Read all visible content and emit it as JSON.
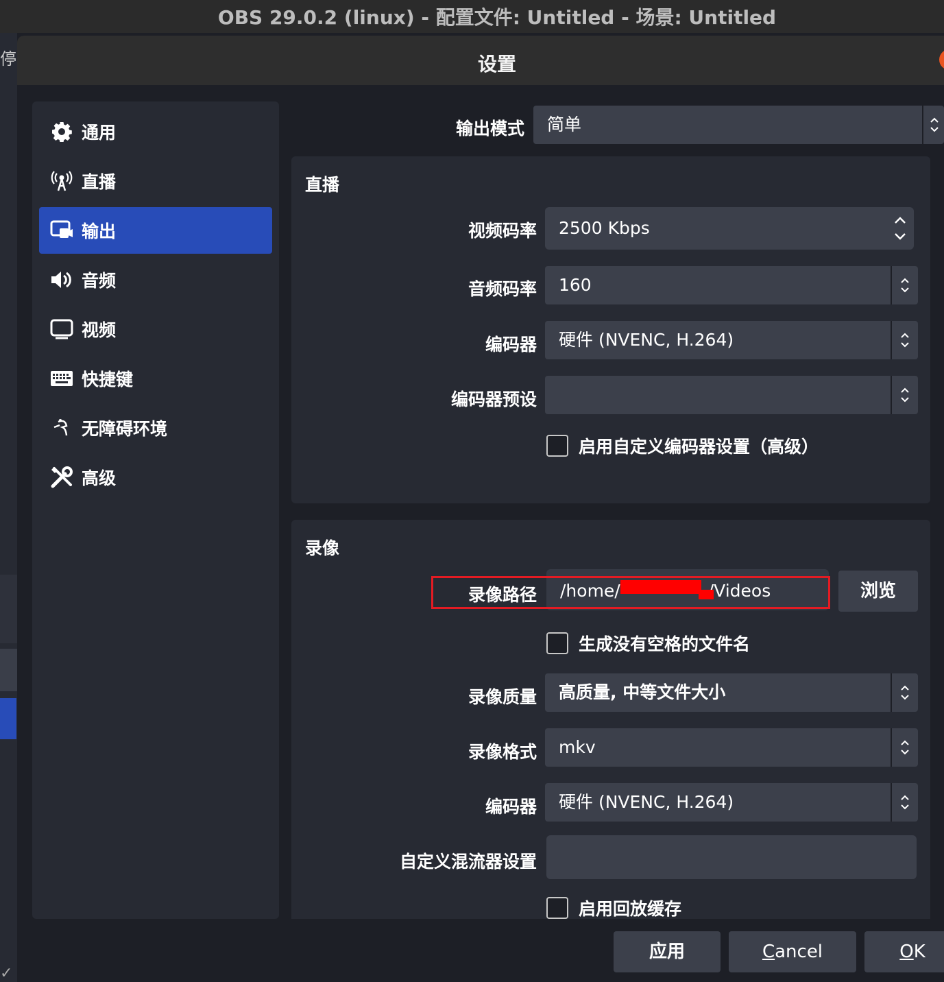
{
  "window_title": "OBS 29.0.2 (linux) - 配置文件: Untitled - 场景: Untitled",
  "background_left_label": "停",
  "dialog": {
    "title": "设置"
  },
  "sidebar": {
    "items": [
      {
        "label": "通用",
        "icon": "gear-icon"
      },
      {
        "label": "直播",
        "icon": "antenna-icon"
      },
      {
        "label": "输出",
        "icon": "output-icon",
        "active": true
      },
      {
        "label": "音频",
        "icon": "speaker-icon"
      },
      {
        "label": "视频",
        "icon": "monitor-icon"
      },
      {
        "label": "快捷键",
        "icon": "keyboard-icon"
      },
      {
        "label": "无障碍环境",
        "icon": "accessibility-icon"
      },
      {
        "label": "高级",
        "icon": "tools-icon"
      }
    ]
  },
  "output_mode": {
    "label": "输出模式",
    "value": "简单"
  },
  "streaming": {
    "title": "直播",
    "video_bitrate": {
      "label": "视频码率",
      "value": "2500 Kbps"
    },
    "audio_bitrate": {
      "label": "音频码率",
      "value": "160"
    },
    "encoder": {
      "label": "编码器",
      "value": "硬件 (NVENC, H.264)"
    },
    "encoder_preset": {
      "label": "编码器预设",
      "value": ""
    },
    "custom_encoder": {
      "label": "启用自定义编码器设置（高级）",
      "checked": false
    }
  },
  "recording": {
    "title": "录像",
    "path": {
      "label": "录像路径",
      "value_prefix": "/home/",
      "value_suffix": "/Videos",
      "browse_label": "浏览"
    },
    "no_space_filename": {
      "label": "生成没有空格的文件名",
      "checked": false
    },
    "quality": {
      "label": "录像质量",
      "value": "高质量, 中等文件大小"
    },
    "format": {
      "label": "录像格式",
      "value": "mkv"
    },
    "encoder": {
      "label": "编码器",
      "value": "硬件 (NVENC, H.264)"
    },
    "muxer": {
      "label": "自定义混流器设置",
      "value": ""
    },
    "replay_buffer": {
      "label": "启用回放缓存",
      "checked": false
    }
  },
  "footer": {
    "apply_label": "应用",
    "cancel_label": "Cancel",
    "ok_label": "OK"
  },
  "colors": {
    "accent": "#284cb8",
    "highlight_box": "#e31b23",
    "redaction": "#ff0000",
    "close_button": "#e95420"
  }
}
